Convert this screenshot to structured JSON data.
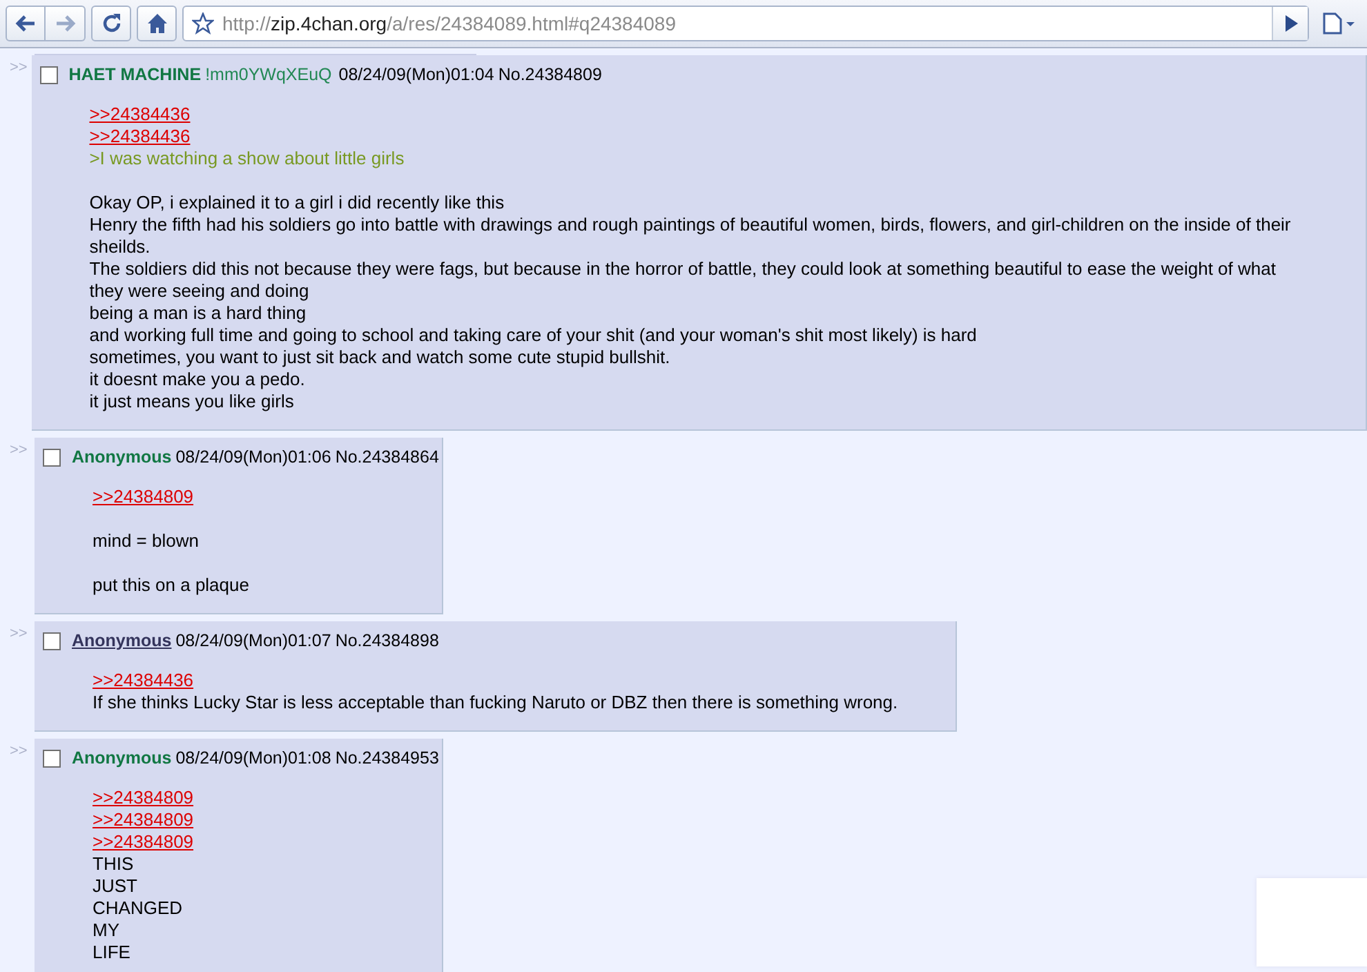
{
  "browser": {
    "url": {
      "scheme": "http://",
      "host": "zip.4chan.org",
      "path": "/a/res/24384089.html#q24384089"
    }
  },
  "posts": [
    {
      "marker": ">>",
      "checked": false,
      "name": "HAET MACHINE",
      "name_link": false,
      "tripcode": "!mm0YWqXEuQ",
      "date": "08/24/09(Mon)01:04",
      "number": "No.24384809",
      "blocks": [
        [
          {
            "kind": "quotelink",
            "text": ">>24384436"
          },
          {
            "kind": "quotelink",
            "text": ">>24384436"
          },
          {
            "kind": "greentext",
            "text": ">I was watching a show about little girls"
          }
        ],
        [
          {
            "kind": "text",
            "text": "Okay OP, i explained it to a girl i did recently like this"
          },
          {
            "kind": "text",
            "text": "Henry the fifth had his soldiers go into battle with drawings and rough paintings of beautiful women, birds, flowers, and girl-children on the inside of their sheilds."
          },
          {
            "kind": "text",
            "text": "The soldiers did this not because they were fags, but because in the horror of battle, they could look at something beautiful to ease the weight of what they were seeing and doing"
          },
          {
            "kind": "text",
            "text": "being a man is a hard thing"
          },
          {
            "kind": "text",
            "text": "and working full time and going to school and taking care of your shit (and your woman's shit most likely) is hard"
          },
          {
            "kind": "text",
            "text": "sometimes, you want to just sit back and watch some cute stupid bullshit."
          },
          {
            "kind": "text",
            "text": "it doesnt make you a pedo."
          },
          {
            "kind": "text",
            "text": "it just means you like girls"
          }
        ]
      ]
    },
    {
      "marker": ">>",
      "checked": false,
      "name": "Anonymous",
      "name_link": false,
      "date": "08/24/09(Mon)01:06",
      "number": "No.24384864",
      "blocks": [
        [
          {
            "kind": "quotelink",
            "text": ">>24384809"
          }
        ],
        [
          {
            "kind": "text",
            "text": "mind = blown"
          }
        ],
        [
          {
            "kind": "text",
            "text": "put this on a plaque"
          }
        ]
      ]
    },
    {
      "marker": ">>",
      "checked": false,
      "name": "Anonymous",
      "name_link": true,
      "date": "08/24/09(Mon)01:07",
      "number": "No.24384898",
      "blocks": [
        [
          {
            "kind": "quotelink",
            "text": ">>24384436"
          },
          {
            "kind": "text",
            "text": "If she thinks Lucky Star is less acceptable than fucking Naruto or DBZ then there is something wrong."
          }
        ]
      ]
    },
    {
      "marker": ">>",
      "checked": false,
      "name": "Anonymous",
      "name_link": false,
      "date": "08/24/09(Mon)01:08",
      "number": "No.24384953",
      "blocks": [
        [
          {
            "kind": "quotelink",
            "text": ">>24384809"
          },
          {
            "kind": "quotelink",
            "text": ">>24384809"
          },
          {
            "kind": "quotelink",
            "text": ">>24384809"
          },
          {
            "kind": "text",
            "text": "THIS"
          },
          {
            "kind": "text",
            "text": "JUST"
          },
          {
            "kind": "text",
            "text": "CHANGED"
          },
          {
            "kind": "text",
            "text": "MY"
          },
          {
            "kind": "text",
            "text": "LIFE"
          }
        ]
      ]
    }
  ]
}
